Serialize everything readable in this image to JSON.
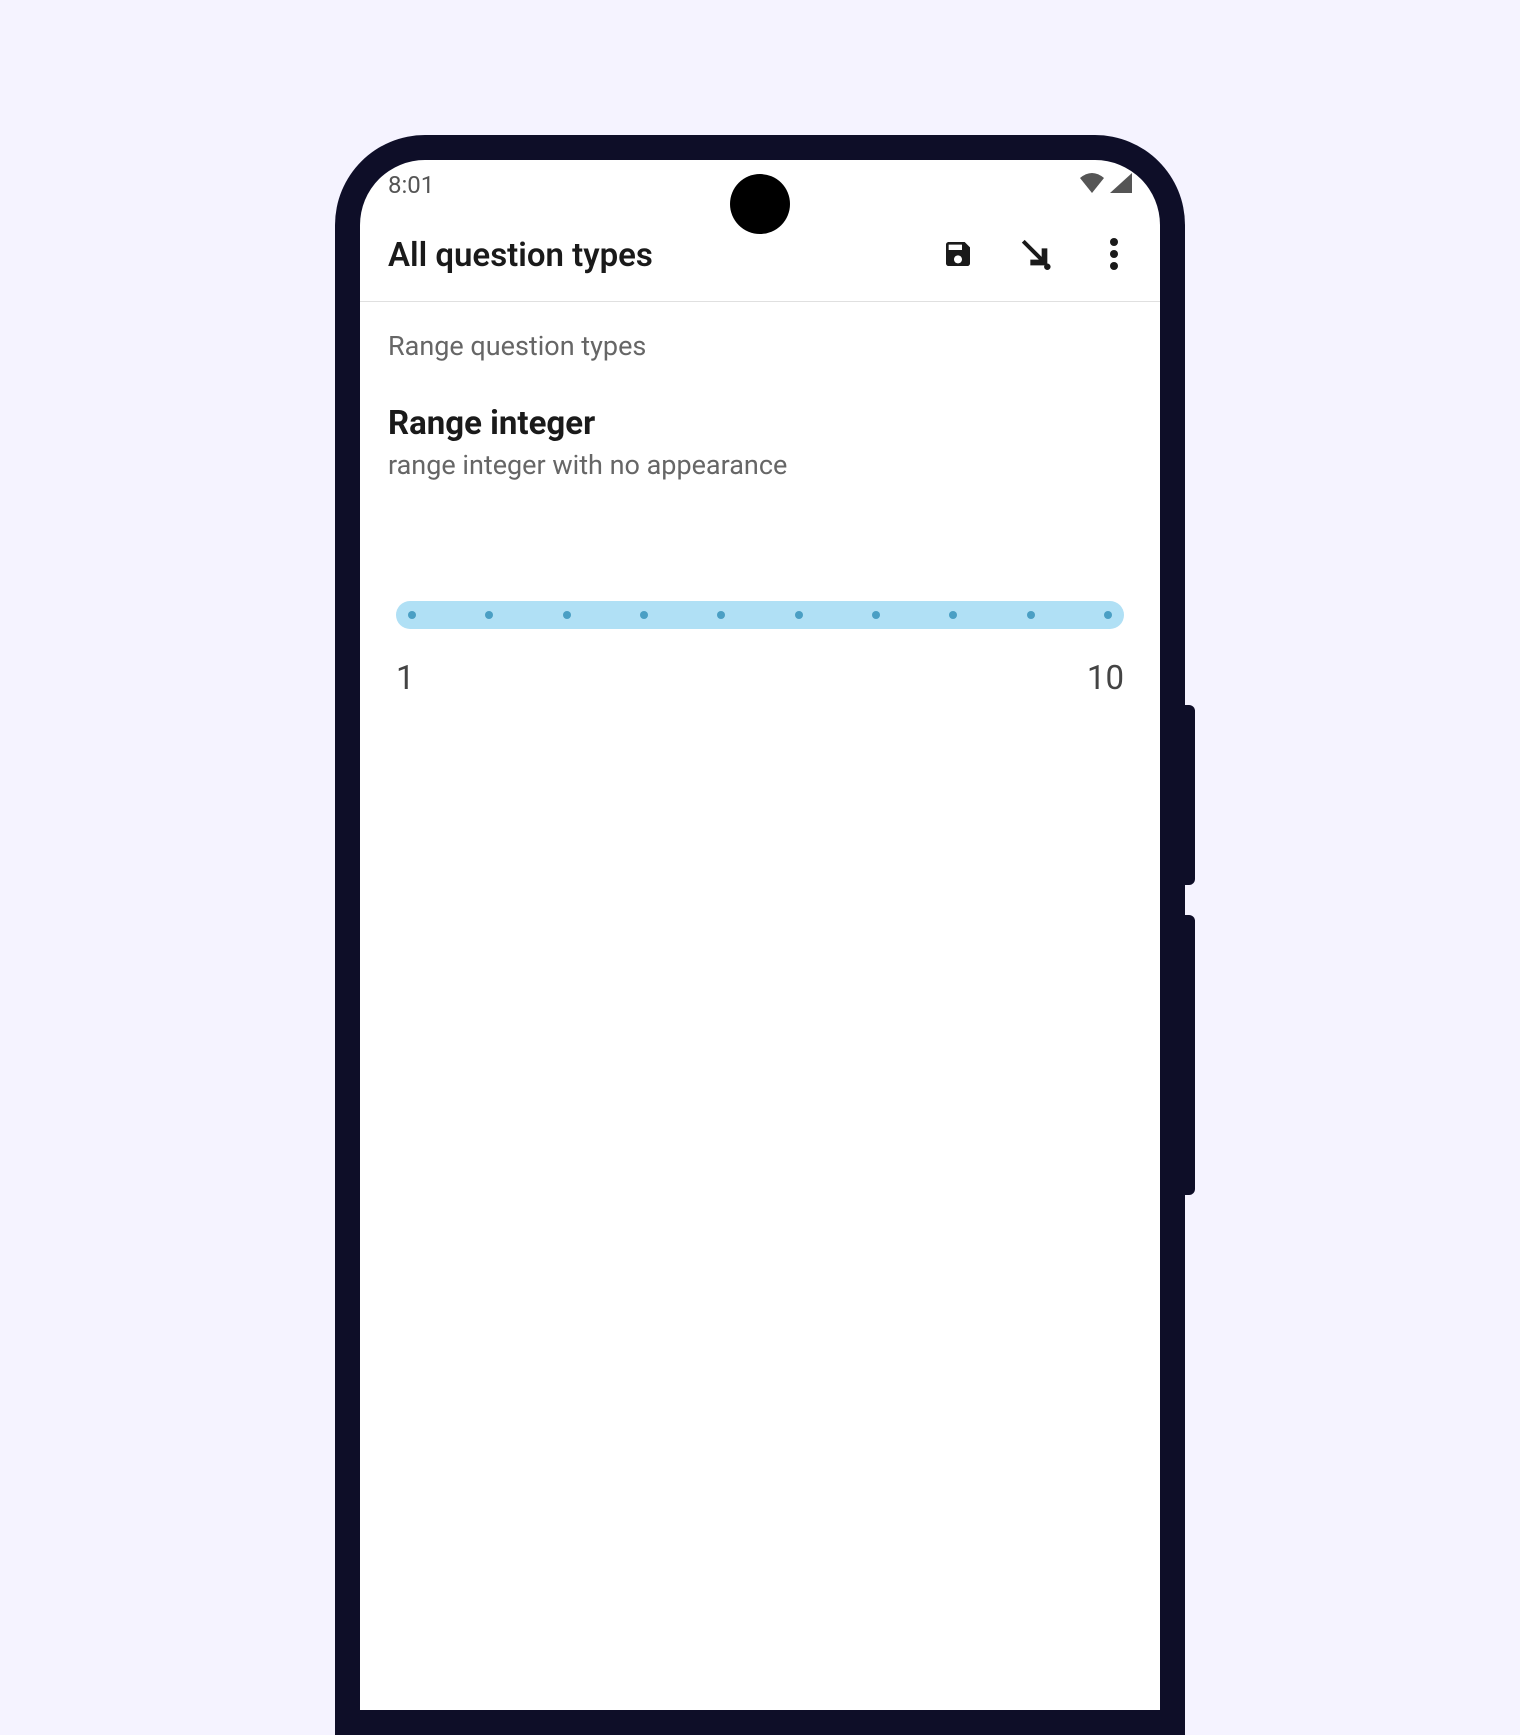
{
  "statusBar": {
    "time": "8:01"
  },
  "appBar": {
    "title": "All question types"
  },
  "content": {
    "groupLabel": "Range question types",
    "questionTitle": "Range integer",
    "questionHint": "range integer with no appearance",
    "slider": {
      "min": "1",
      "max": "10",
      "tickCount": 10
    }
  }
}
